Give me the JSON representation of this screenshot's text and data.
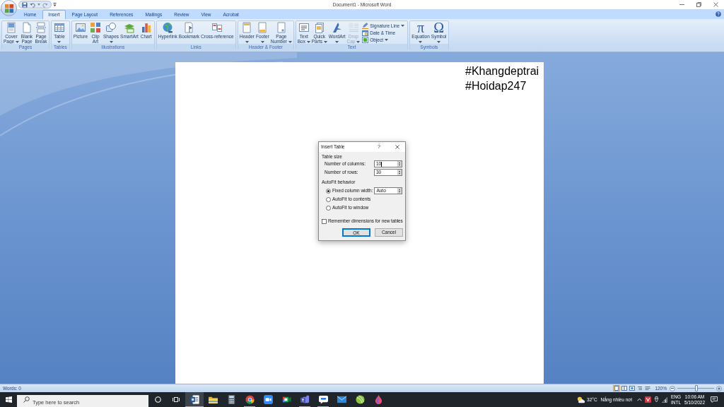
{
  "window": {
    "title": "Document1 - Microsoft Word"
  },
  "tabs": [
    {
      "label": "Home",
      "selected": false
    },
    {
      "label": "Insert",
      "selected": true
    },
    {
      "label": "Page Layout",
      "selected": false
    },
    {
      "label": "References",
      "selected": false
    },
    {
      "label": "Mailings",
      "selected": false
    },
    {
      "label": "Review",
      "selected": false
    },
    {
      "label": "View",
      "selected": false
    },
    {
      "label": "Acrobat",
      "selected": false
    }
  ],
  "ribbon": {
    "groups": [
      {
        "label": "Pages",
        "buttons": [
          {
            "lines": [
              "Cover",
              "Page"
            ],
            "menu": true,
            "disabled": false
          },
          {
            "lines": [
              "Blank",
              "Page"
            ],
            "menu": false,
            "disabled": false
          },
          {
            "lines": [
              "Page",
              "Break"
            ],
            "menu": false,
            "disabled": false
          }
        ]
      },
      {
        "label": "Tables",
        "buttons": [
          {
            "lines": [
              "Table"
            ],
            "menu": true,
            "disabled": false
          }
        ]
      },
      {
        "label": "Illustrations",
        "buttons": [
          {
            "lines": [
              "Picture"
            ],
            "menu": false,
            "disabled": false
          },
          {
            "lines": [
              "Clip",
              "Art"
            ],
            "menu": false,
            "disabled": false
          },
          {
            "lines": [
              "Shapes"
            ],
            "menu": true,
            "disabled": false
          },
          {
            "lines": [
              "SmartArt"
            ],
            "menu": false,
            "disabled": false
          },
          {
            "lines": [
              "Chart"
            ],
            "menu": false,
            "disabled": false
          }
        ]
      },
      {
        "label": "Links",
        "buttons": [
          {
            "lines": [
              "Hyperlink"
            ],
            "menu": false,
            "disabled": false
          },
          {
            "lines": [
              "Bookmark"
            ],
            "menu": false,
            "disabled": false
          },
          {
            "lines": [
              "Cross-reference"
            ],
            "menu": false,
            "disabled": false
          }
        ]
      },
      {
        "label": "Header & Footer",
        "buttons": [
          {
            "lines": [
              "Header"
            ],
            "menu": true,
            "disabled": false
          },
          {
            "lines": [
              "Footer"
            ],
            "menu": true,
            "disabled": false
          },
          {
            "lines": [
              "Page",
              "Number"
            ],
            "menu": true,
            "disabled": false
          }
        ]
      },
      {
        "label": "Text",
        "buttons": [
          {
            "lines": [
              "Text",
              "Box"
            ],
            "menu": true,
            "disabled": false
          },
          {
            "lines": [
              "Quick",
              "Parts"
            ],
            "menu": true,
            "disabled": false
          },
          {
            "lines": [
              "WordArt"
            ],
            "menu": true,
            "disabled": false
          },
          {
            "lines": [
              "Drop",
              "Cap"
            ],
            "menu": true,
            "disabled": true
          }
        ],
        "small_buttons": [
          {
            "label": "Signature Line",
            "menu": true
          },
          {
            "label": "Date & Time",
            "menu": false
          },
          {
            "label": "Object",
            "menu": true
          }
        ]
      },
      {
        "label": "Symbols",
        "buttons": [
          {
            "glyph": "π",
            "lines": [
              "Equation"
            ],
            "menu": true,
            "disabled": false
          },
          {
            "glyph": "Ω",
            "lines": [
              "Symbol"
            ],
            "menu": true,
            "disabled": false
          }
        ]
      }
    ]
  },
  "document": {
    "paragraphs": [
      "#Khangdeptrai",
      "#Hoidap247"
    ]
  },
  "dialog": {
    "title": "Insert Table",
    "help_button": "?",
    "table_size": {
      "heading": "Table size",
      "fields": [
        {
          "label": "Number of columns:",
          "value": "10",
          "focused": true
        },
        {
          "label": "Number of rows:",
          "value": "30",
          "focused": false
        }
      ]
    },
    "autofit": {
      "heading": "AutoFit behavior",
      "options": [
        {
          "label": "Fixed column width:",
          "selected": true,
          "value": "Auto"
        },
        {
          "label": "AutoFit to contents",
          "selected": false
        },
        {
          "label": "AutoFit to window",
          "selected": false
        }
      ]
    },
    "remember": {
      "label": "Remember dimensions for new tables",
      "checked": false
    },
    "buttons": [
      {
        "label": "OK",
        "default": true
      },
      {
        "label": "Cancel",
        "default": false
      }
    ]
  },
  "status_bar": {
    "word_count": "Words: 0",
    "views": [
      {
        "selected": true
      },
      {
        "selected": false
      },
      {
        "selected": false
      },
      {
        "selected": false
      },
      {
        "selected": false
      }
    ],
    "zoom": "120%",
    "zoom_slider": {
      "level": 0.52
    }
  },
  "taskbar": {
    "search": {
      "placeholder": "Type here to search"
    },
    "apps": [
      {
        "selected": true,
        "running": true
      },
      {
        "selected": false,
        "running": false
      },
      {
        "selected": false,
        "running": false
      },
      {
        "selected": false,
        "running": true
      },
      {
        "selected": false,
        "running": false
      },
      {
        "selected": false,
        "running": false
      },
      {
        "selected": false,
        "running": true
      },
      {
        "selected": false,
        "running": true
      },
      {
        "selected": false,
        "running": false
      },
      {
        "selected": false,
        "running": false
      },
      {
        "selected": false,
        "running": false
      }
    ],
    "weather": {
      "temperature": "32°C",
      "condition": "Nắng nhiều nơi"
    },
    "tray": {
      "language": "ENG",
      "layout": "INTL",
      "time": "10:06 AM",
      "date": "5/10/2022"
    }
  }
}
